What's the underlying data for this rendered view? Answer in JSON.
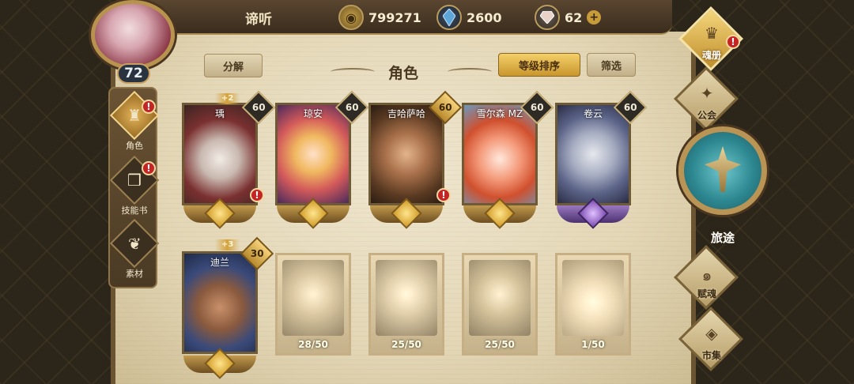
{
  "player": {
    "name": "谛听",
    "level": "72"
  },
  "resources": {
    "gold": "799271",
    "crystal": "2600",
    "gem": "62",
    "gem_plus": "+"
  },
  "header": {
    "title": "角色",
    "decompose": "分解",
    "sort": "等级排序",
    "filter": "筛选"
  },
  "left_tabs": [
    {
      "label": "角色",
      "icon": "helmet-icon",
      "alert": true
    },
    {
      "label": "技能书",
      "icon": "book-icon",
      "alert": true
    },
    {
      "label": "素材",
      "icon": "material-icon",
      "alert": false
    }
  ],
  "alert_mark": "!",
  "owned_heroes": [
    {
      "name": "瑀",
      "level": "60",
      "plus": "+2",
      "alert": true
    },
    {
      "name": "琼安",
      "level": "60",
      "plus": "",
      "alert": false
    },
    {
      "name": "吉哈萨哈",
      "level": "60",
      "plus": "",
      "alert": true,
      "gold_level": true
    },
    {
      "name": "雪尔森 MZ",
      "level": "60",
      "plus": "",
      "alert": false
    },
    {
      "name": "卷云",
      "level": "60",
      "plus": "",
      "alert": false,
      "crest": "purple"
    },
    {
      "name": "迪兰",
      "level": "30",
      "plus": "+3",
      "alert": false,
      "gold_level": true
    }
  ],
  "locked_heroes": [
    {
      "shards": "28/50"
    },
    {
      "shards": "25/50"
    },
    {
      "shards": "25/50"
    },
    {
      "shards": "1/50"
    }
  ],
  "right_nav": {
    "soul": "魂册",
    "guild": "公会",
    "journey": "旅途",
    "talent": "赋魂",
    "market": "市集"
  },
  "colors": {
    "accent_gold": "#c9962d",
    "parchment": "#e3d6b5",
    "alert_red": "#c42424"
  }
}
